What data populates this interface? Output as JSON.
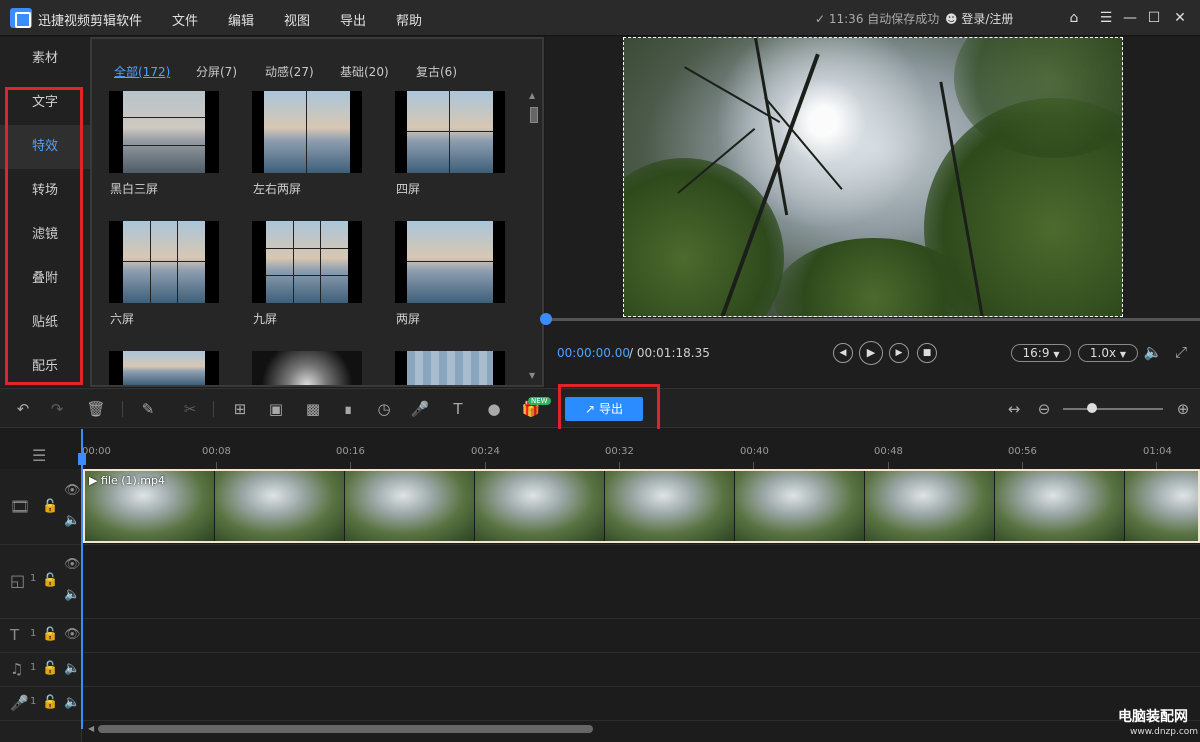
{
  "app": {
    "title": "迅捷视频剪辑软件",
    "menu": [
      "文件",
      "编辑",
      "视图",
      "导出",
      "帮助"
    ],
    "autosave": "✓ 11:36 自动保存成功",
    "login": "登录/注册"
  },
  "leftnav": {
    "items": [
      "素材",
      "文字",
      "特效",
      "转场",
      "滤镜",
      "叠附",
      "贴纸",
      "配乐"
    ],
    "active": "特效"
  },
  "library": {
    "tabs": [
      "全部(172)",
      "分屏(7)",
      "动感(27)",
      "基础(20)",
      "复古(6)"
    ],
    "active_tab": "全部(172)",
    "items": [
      {
        "label": "黑白三屏",
        "icon": "three-screen-bw-effect"
      },
      {
        "label": "左右两屏",
        "icon": "left-right-split-effect"
      },
      {
        "label": "四屏",
        "icon": "four-screen-effect"
      },
      {
        "label": "六屏",
        "icon": "six-screen-effect"
      },
      {
        "label": "九屏",
        "icon": "nine-screen-effect"
      },
      {
        "label": "两屏",
        "icon": "two-screen-effect"
      },
      {
        "label": "",
        "icon": "effect-thumb"
      },
      {
        "label": "",
        "icon": "effect-thumb"
      },
      {
        "label": "",
        "icon": "effect-thumb"
      }
    ]
  },
  "player": {
    "time_current": "00:00:00.00",
    "time_total": "/ 00:01:18.35",
    "aspect": "16:9",
    "speed": "1.0x"
  },
  "toolbar": {
    "export_label": "导出",
    "new_badge": "NEW"
  },
  "timeline": {
    "ticks": [
      "00:00",
      "00:08",
      "00:16",
      "00:24",
      "00:32",
      "00:40",
      "00:48",
      "00:56",
      "01:04"
    ],
    "clip_name": "file (1).mp4",
    "track_numbers": [
      "1",
      "1",
      "1",
      "1"
    ]
  },
  "watermark": {
    "main": "电脑装配网",
    "sub": "www.dnzp.com"
  },
  "colors": {
    "accent": "#2b8cff",
    "highlight": "#e0242a",
    "active_text": "#4da3ff"
  }
}
